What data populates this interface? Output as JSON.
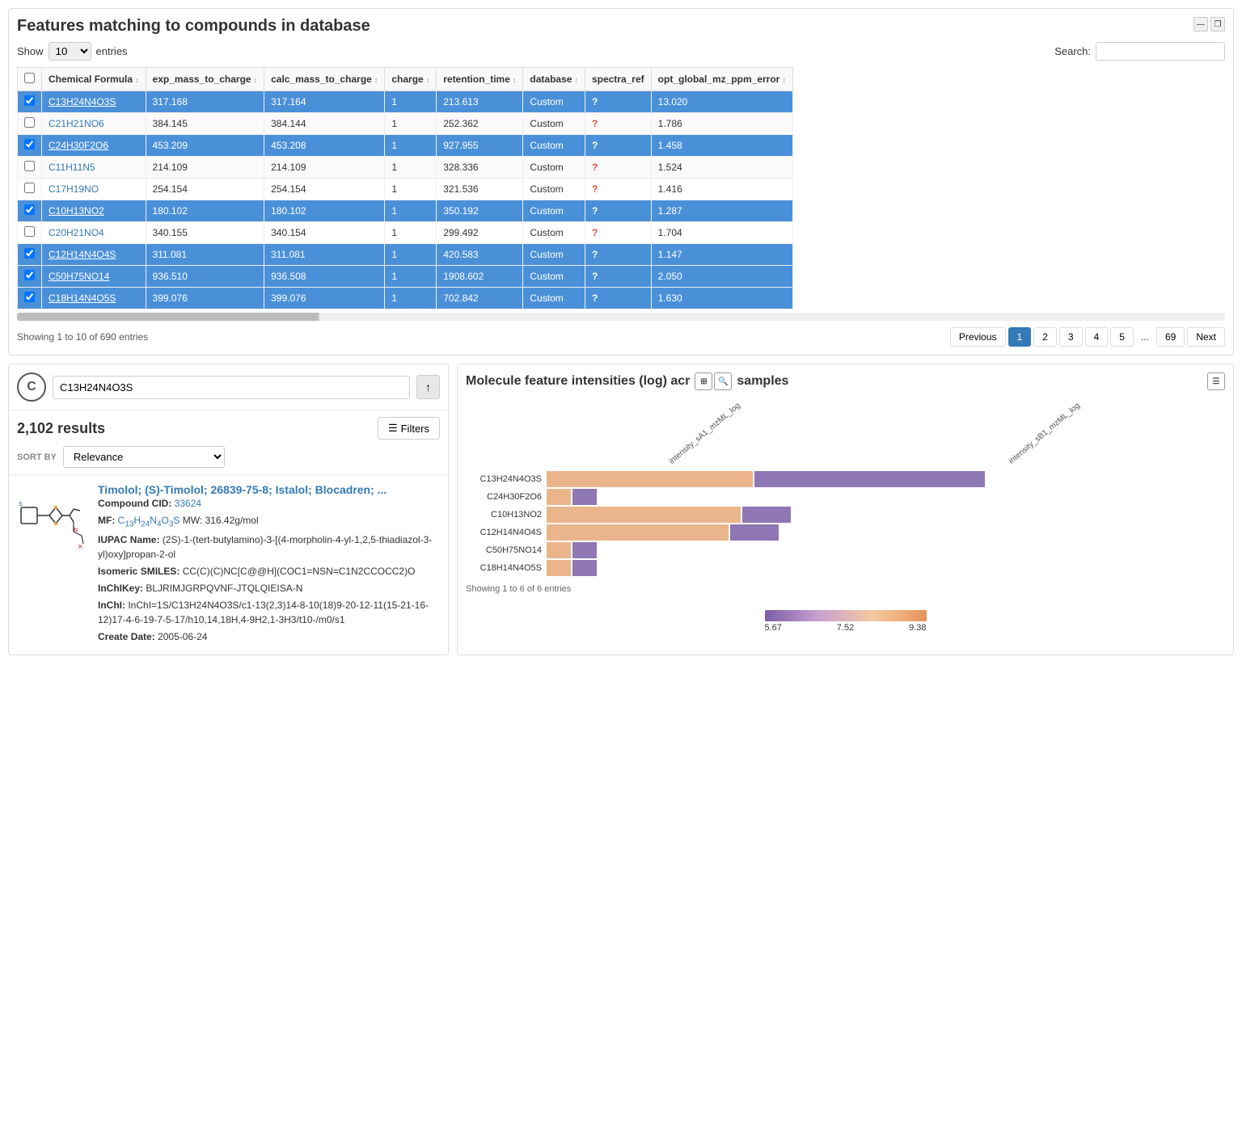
{
  "page": {
    "title": "Features matching to compounds in database"
  },
  "table_controls": {
    "show_label": "Show",
    "entries_label": "entries",
    "entries_value": "10",
    "search_label": "Search:"
  },
  "table": {
    "columns": [
      {
        "id": "checkbox",
        "label": ""
      },
      {
        "id": "chemical_formula",
        "label": "Chemical Formula"
      },
      {
        "id": "exp_mass_to_charge",
        "label": "exp_mass_to_charge"
      },
      {
        "id": "calc_mass_to_charge",
        "label": "calc_mass_to_charge"
      },
      {
        "id": "charge",
        "label": "charge"
      },
      {
        "id": "retention_time",
        "label": "retention_time"
      },
      {
        "id": "database",
        "label": "database"
      },
      {
        "id": "spectra_ref",
        "label": "spectra_ref"
      },
      {
        "id": "opt_global_mz_ppm_error",
        "label": "opt_global_mz_ppm_error"
      }
    ],
    "rows": [
      {
        "selected": true,
        "formula": "C13H24N4O3S",
        "exp_mz": "317.168",
        "calc_mz": "317.164",
        "charge": "1",
        "rt": "213.613",
        "db": "Custom",
        "spectra_ref": "?",
        "ppm": "13.020"
      },
      {
        "selected": false,
        "formula": "C21H21NO6",
        "exp_mz": "384.145",
        "calc_mz": "384.144",
        "charge": "1",
        "rt": "252.362",
        "db": "Custom",
        "spectra_ref": "?",
        "ppm": "1.786"
      },
      {
        "selected": true,
        "formula": "C24H30F2O6",
        "exp_mz": "453.209",
        "calc_mz": "453.208",
        "charge": "1",
        "rt": "927.955",
        "db": "Custom",
        "spectra_ref": "?",
        "ppm": "1.458"
      },
      {
        "selected": false,
        "formula": "C11H11N5",
        "exp_mz": "214.109",
        "calc_mz": "214.109",
        "charge": "1",
        "rt": "328.336",
        "db": "Custom",
        "spectra_ref": "?",
        "ppm": "1.524"
      },
      {
        "selected": false,
        "formula": "C17H19NO",
        "exp_mz": "254.154",
        "calc_mz": "254.154",
        "charge": "1",
        "rt": "321.536",
        "db": "Custom",
        "spectra_ref": "?",
        "ppm": "1.416"
      },
      {
        "selected": true,
        "formula": "C10H13NO2",
        "exp_mz": "180.102",
        "calc_mz": "180.102",
        "charge": "1",
        "rt": "350.192",
        "db": "Custom",
        "spectra_ref": "?",
        "ppm": "1.287"
      },
      {
        "selected": false,
        "formula": "C20H21NO4",
        "exp_mz": "340.155",
        "calc_mz": "340.154",
        "charge": "1",
        "rt": "299.492",
        "db": "Custom",
        "spectra_ref": "?",
        "ppm": "1.704"
      },
      {
        "selected": true,
        "formula": "C12H14N4O4S",
        "exp_mz": "311.081",
        "calc_mz": "311.081",
        "charge": "1",
        "rt": "420.583",
        "db": "Custom",
        "spectra_ref": "?",
        "ppm": "1.147"
      },
      {
        "selected": true,
        "formula": "C50H75NO14",
        "exp_mz": "936.510",
        "calc_mz": "936.508",
        "charge": "1",
        "rt": "1908.602",
        "db": "Custom",
        "spectra_ref": "?",
        "ppm": "2.050"
      },
      {
        "selected": true,
        "formula": "C18H14N4O5S",
        "exp_mz": "399.076",
        "calc_mz": "399.076",
        "charge": "1",
        "rt": "702.842",
        "db": "Custom",
        "spectra_ref": "?",
        "ppm": "1.630"
      }
    ]
  },
  "pagination": {
    "showing": "Showing 1 to 10 of 690 entries",
    "previous": "Previous",
    "next": "Next",
    "pages": [
      "1",
      "2",
      "3",
      "4",
      "5",
      "...",
      "69"
    ],
    "active_page": "1"
  },
  "chem_search": {
    "icon_label": "C",
    "search_value": "C13H24N4O3S",
    "search_btn": "↑",
    "results_count": "2,102 results",
    "filters_btn": "Filters",
    "sort_by_label": "SORT BY",
    "sort_icon": "⇅",
    "sort_value": "Relevance",
    "result": {
      "title": "Timolol; (S)-Timolol; 26839-75-8; Istalol; Blocadren; ...",
      "cid_label": "Compound CID:",
      "cid_value": "33624",
      "mf_label": "MF:",
      "mf_value": "C13H24N4O3S",
      "mw_label": "MW:",
      "mw_value": "316.42g/mol",
      "iupac_label": "IUPAC Name:",
      "iupac_value": "(2S)-1-(tert-butylamino)-3-[(4-morpholin-4-yl-1,2,5-thiadiazol-3-yl)oxy]propan-2-ol",
      "smiles_label": "Isomeric SMILES:",
      "smiles_value": "CC(C)(C)NC[C@@H](COC1=NSN=C1N2CCOCC2)O",
      "inchikey_label": "InChIKey:",
      "inchikey_value": "BLJRIMJGRPQVNF-JTQLQIEISA-N",
      "inchi_label": "InChI:",
      "inchi_value": "InChI=1S/C13H24N4O3S/c1-13(2,3)14-8-10(18)9-20-12-11(15-21-16-12)17-4-6-19-7-5-17/h10,14,18H,4-9H2,1-3H3/t10-/m0/s1",
      "create_date_label": "Create Date:",
      "create_date_value": "2005-06-24"
    }
  },
  "chart": {
    "title": "Molecule feature intensities (log) acr",
    "title_suffix": "samples",
    "showing": "Showing 1 to 6 of 6 entries",
    "col_labels": [
      "intensity_sA1_mzML_log",
      "intensity_sB1_mzML_log"
    ],
    "rows": [
      {
        "label": "C13H24N4O3S",
        "sa1_width": 85,
        "sa1_color": "#e8a878",
        "sb1_width": 95,
        "sb1_color": "#7b5ea7"
      },
      {
        "label": "C24H30F2O6",
        "sa1_width": 10,
        "sa1_color": "#e8a878",
        "sb1_width": 10,
        "sb1_color": "#7b5ea7"
      },
      {
        "label": "C10H13NO2",
        "sa1_width": 80,
        "sa1_color": "#e8a878",
        "sb1_width": 20,
        "sb1_color": "#7b5ea7"
      },
      {
        "label": "C12H14N4O4S",
        "sa1_width": 75,
        "sa1_color": "#e8a878",
        "sb1_width": 20,
        "sb1_color": "#7b5ea7"
      },
      {
        "label": "C50H75NO14",
        "sa1_width": 10,
        "sa1_color": "#e8a878",
        "sb1_width": 10,
        "sb1_color": "#7b5ea7"
      },
      {
        "label": "C18H14N4O5S",
        "sa1_width": 10,
        "sa1_color": "#e8a878",
        "sb1_width": 10,
        "sb1_color": "#7b5ea7"
      }
    ],
    "legend": {
      "min": "5.67",
      "mid": "7.52",
      "max": "9.38"
    }
  },
  "window_buttons": {
    "minimize": "—",
    "maximize": "❐"
  }
}
